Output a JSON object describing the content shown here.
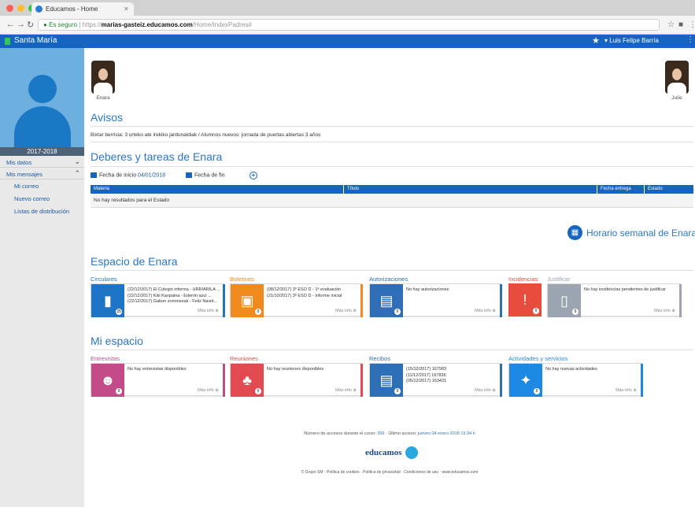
{
  "browser": {
    "tab_title": "Educamos - Home",
    "tab_close": "×",
    "url_secure": "Es seguro",
    "url_scheme": "https://",
    "url_host": "marias-gasteiz.educamos.com",
    "url_path": "/Home/IndexPadres#"
  },
  "colors": {
    "primary": "#1565c0",
    "circulares": "#1e74c6",
    "boletines": "#f08a1c",
    "autorizaciones": "#2f6db8",
    "incidencias": "#e74c3c",
    "justificar": "#9aa5b1",
    "entrevistas": "#c44b8a",
    "reuniones": "#e04a50",
    "recibos": "#2c6fb7",
    "actividades": "#1e88e5"
  },
  "appbar": {
    "school": "Santa María",
    "user": "Luis Felipe Barría"
  },
  "sidebar": {
    "year": "2017-2018",
    "items": [
      {
        "label": "Mis datos"
      },
      {
        "label": "Mis mensajes"
      }
    ],
    "subitems": [
      {
        "label": "Mi correo"
      },
      {
        "label": "Nuevo correo"
      },
      {
        "label": "Listas de distribución"
      }
    ]
  },
  "students": [
    {
      "name": "Enara"
    },
    {
      "name": "Julie"
    }
  ],
  "avisos": {
    "title": "Avisos",
    "text": "Bixtar berrisia: 3 urteko ate irekiko jardunaldiak / Alumnos nuevos: jornada de puertas abiertas 3 años"
  },
  "deberes": {
    "title": "Deberes y tareas de Enara",
    "start_label": "Fecha de inicio",
    "start_value": "04/01/2018",
    "end_label": "Fecha de fin",
    "columns": [
      "Materia",
      "Título",
      "Fecha entrega",
      "Estado"
    ],
    "empty": "No hay resultados para el Estado"
  },
  "horario": {
    "label": "Horario semanal de Enara"
  },
  "espacio": {
    "title": "Espacio de Enara",
    "cards": [
      {
        "label": "Circulares",
        "lines": [
          "(22/12/2017) El Colegio informa - URRIARILA ...",
          "(22/12/2017) Kiki Kanpaina - Ederrin azul ...",
          "(22/12/2017) Gabon zorionezak - Feliz Navid..."
        ],
        "more": "Más info",
        "badge": "25"
      },
      {
        "label": "Boletines",
        "lines": [
          "(08/12/2017) 3º ESO D - 1ª evaluación",
          "(21/10/2017) 3º ESO D - Informe inicial"
        ],
        "more": "Más info",
        "badge": "0"
      },
      {
        "label": "Autorizaciones",
        "lines": [
          "No hay autorizaciones"
        ],
        "more": "Más info",
        "badge": "0"
      },
      {
        "label": "Incidencias",
        "label2": "Justificar",
        "lines": [
          "No hay incidencias pendientes de justificar"
        ],
        "more": "Más info",
        "badge": "0",
        "badge2": "0"
      }
    ]
  },
  "mi_espacio": {
    "title": "Mi espacio",
    "cards": [
      {
        "label": "Entrevistas",
        "lines": [
          "No hay entrevistas disponibles"
        ],
        "more": "Más info",
        "badge": "0"
      },
      {
        "label": "Reuniones",
        "lines": [
          "No hay reuniones disponibles"
        ],
        "more": "Más info",
        "badge": "0"
      },
      {
        "label": "Recibos",
        "lines": [
          "(15/12/2017) 167983",
          "(11/12/2017) 167836",
          "(05/12/2017) 163431"
        ],
        "more": "Más info",
        "badge": "0"
      },
      {
        "label": "Actividades y servicios",
        "lines": [
          "No hay nuevas actividades"
        ],
        "more": "Más info",
        "badge": "0"
      }
    ]
  },
  "footer": {
    "access_prefix": "Número de accesos durante el curso:",
    "access_count": "399",
    "last_prefix": "Último acceso:",
    "last_value": "jueves 04 enero 2018 19:34 h",
    "logo": "educamos",
    "links": "© Grupo SM · Política de cookies · Política de privacidad · Condiciones de uso · www.educamos.com"
  }
}
